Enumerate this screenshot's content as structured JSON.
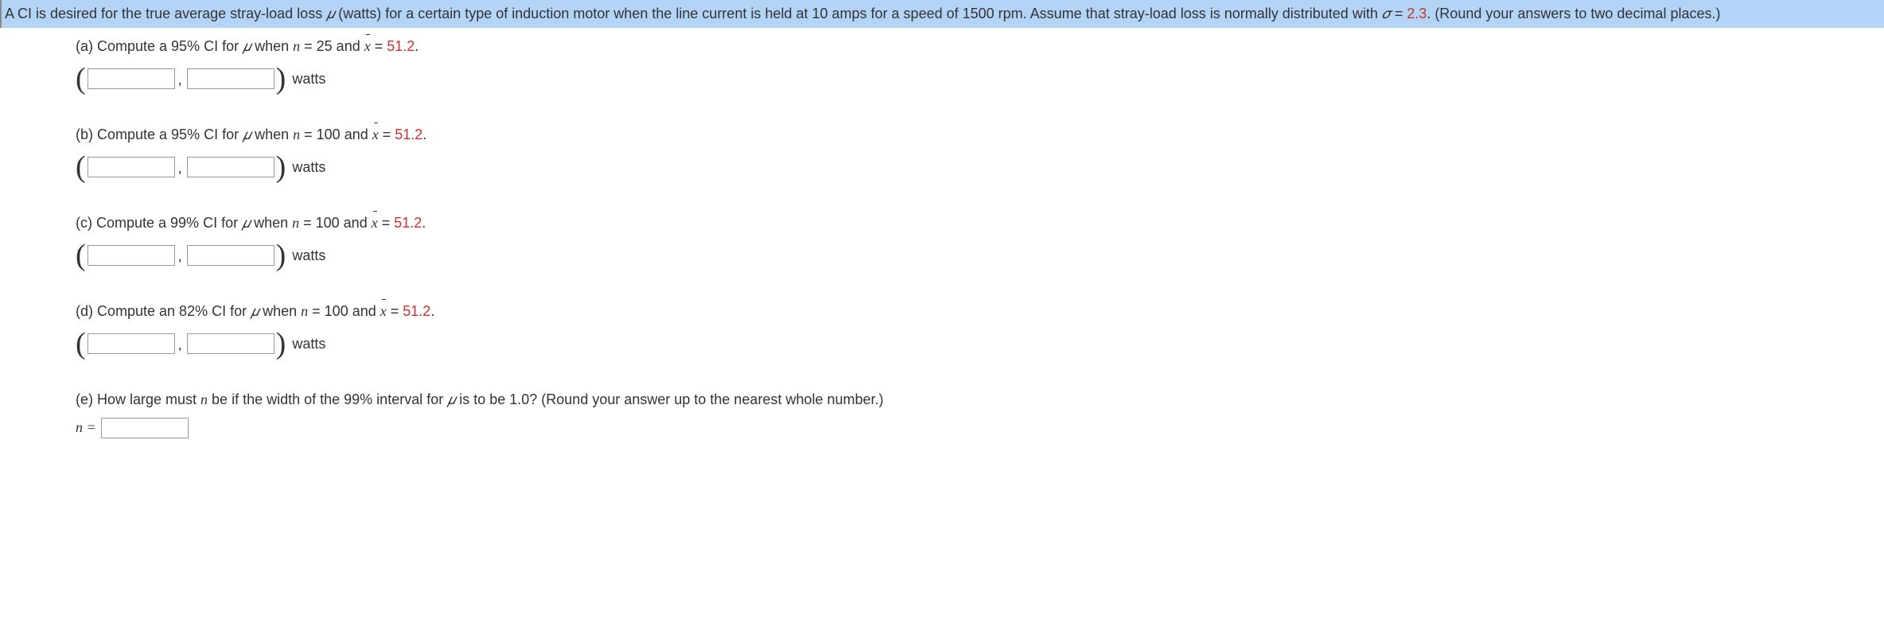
{
  "intro": {
    "prefix": "A CI is desired for the true average stray-load loss ",
    "mu": "𝜇",
    "mid1": " (watts) for a certain type of induction motor when the line current is held at 10 amps for a speed of 1500 rpm. Assume that stray-load loss is normally distributed with ",
    "sigma": "𝜎",
    "eq": " = ",
    "sigmaVal": "2.3",
    "end": ". (Round your answers to two decimal places.)"
  },
  "parts": {
    "a": {
      "label": "(a) Compute a 95% CI for ",
      "mu": "𝜇",
      "when": " when ",
      "nvar": "n",
      "neq": " = 25 and ",
      "xbar": "x",
      "xeq": " = ",
      "xval": "51.2",
      "period": ".",
      "units": "watts"
    },
    "b": {
      "label": "(b) Compute a 95% CI for ",
      "mu": "𝜇",
      "when": " when ",
      "nvar": "n",
      "neq": " = 100 and ",
      "xbar": "x",
      "xeq": " = ",
      "xval": "51.2",
      "period": ".",
      "units": "watts"
    },
    "c": {
      "label": "(c) Compute a 99% CI for ",
      "mu": "𝜇",
      "when": " when ",
      "nvar": "n",
      "neq": " = 100 and ",
      "xbar": "x",
      "xeq": " = ",
      "xval": "51.2",
      "period": ".",
      "units": "watts"
    },
    "d": {
      "label": "(d) Compute an 82% CI for ",
      "mu": "𝜇",
      "when": " when ",
      "nvar": "n",
      "neq": " = 100 and ",
      "xbar": "x",
      "xeq": " = ",
      "xval": "51.2",
      "period": ".",
      "units": "watts"
    },
    "e": {
      "label": "(e) How large must ",
      "nvar": "n",
      "mid": " be if the width of the 99% interval for ",
      "mu": "𝜇",
      "end": " is to be 1.0? (Round your answer up to the nearest whole number.)",
      "nEq": "n ="
    }
  }
}
